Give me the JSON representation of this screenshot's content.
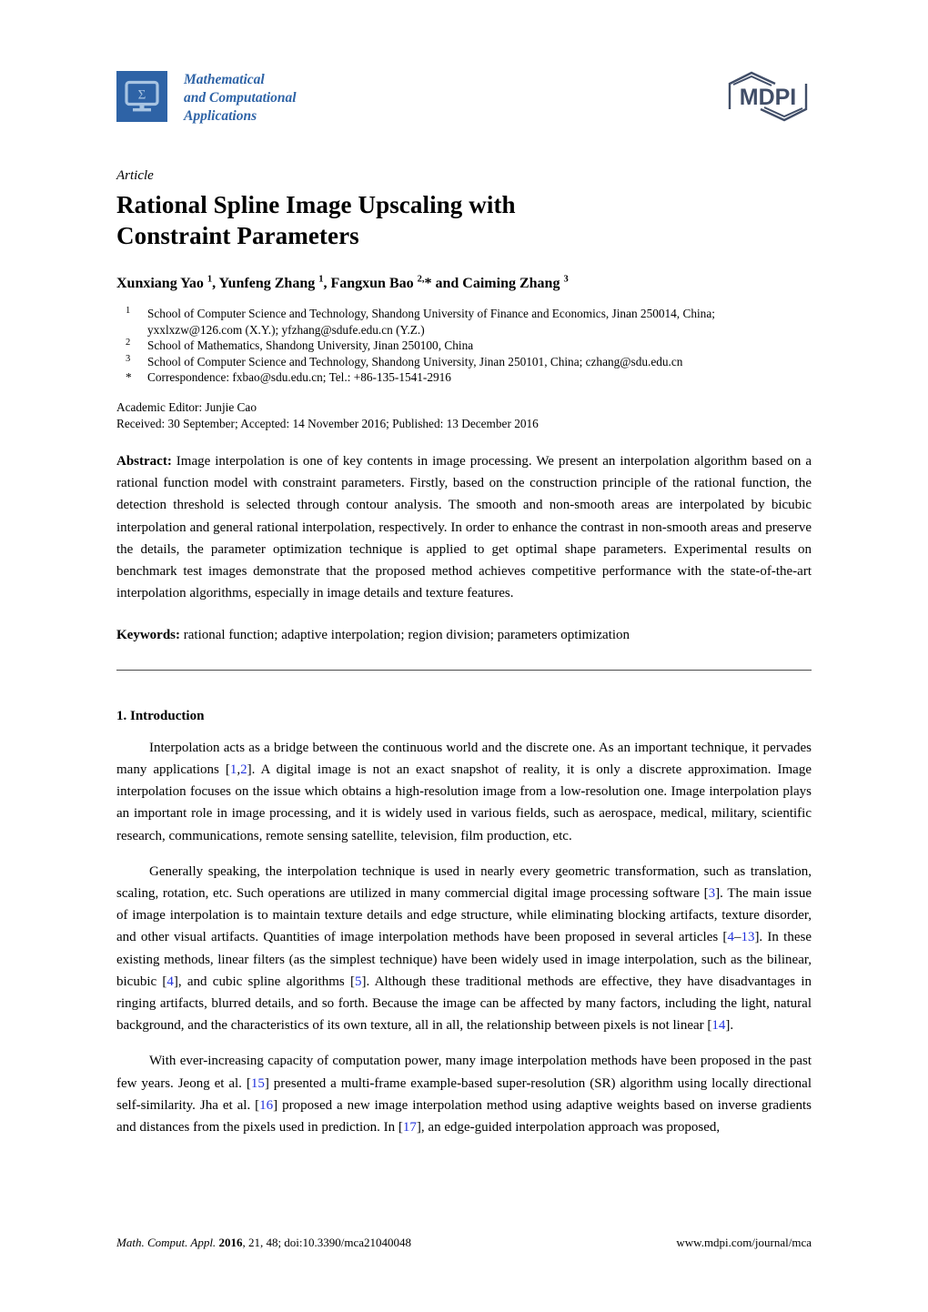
{
  "masthead": {
    "journal_name_lines": [
      "Mathematical",
      "and Computational",
      "Applications"
    ],
    "logo_sigma": "Σ",
    "publisher_logo_text": "MDPI",
    "brand_color": "#2E63A6",
    "publisher_color": "#414E68"
  },
  "article": {
    "type": "Article",
    "title_lines": [
      "Rational Spline Image Upscaling with",
      "Constraint Parameters"
    ],
    "authors_html": "Xunxiang Yao <sup>1</sup>, Yunfeng Zhang <sup>1</sup>, Fangxun Bao <sup>2,</sup>* and Caiming Zhang <sup>3</sup>"
  },
  "affiliations": [
    {
      "mark": "1",
      "text": "School of Computer Science and Technology, Shandong University of Finance and Economics, Jinan 250014, China; yxxlxzw@126.com (X.Y.); yfzhang@sdufe.edu.cn (Y.Z.)"
    },
    {
      "mark": "2",
      "text": "School of Mathematics, Shandong University, Jinan 250100, China"
    },
    {
      "mark": "3",
      "text": "School of Computer Science and Technology, Shandong University, Jinan 250101, China; czhang@sdu.edu.cn"
    },
    {
      "mark": "*",
      "text": "Correspondence: fxbao@sdu.edu.cn; Tel.: +86-135-1541-2916"
    }
  ],
  "editorial": {
    "academic_editor": "Academic Editor: Junjie Cao",
    "dates": "Received: 30 September; Accepted: 14 November 2016; Published: 13 December 2016"
  },
  "abstract": {
    "label": "Abstract:",
    "text": "Image interpolation is one of key contents in image processing. We present an interpolation algorithm based on a rational function model with constraint parameters. Firstly, based on the construction principle of the rational function, the detection  threshold is selected through contour analysis. The smooth and non-smooth areas are interpolated by bicubic interpolation and general rational interpolation, respectively. In order to enhance the contrast in non-smooth areas and preserve the details, the parameter optimization technique is applied to get optimal shape parameters. Experimental results on benchmark test images demonstrate that the proposed method achieves competitive performance with the state-of-the-art interpolation algorithms, especially in image details and texture features."
  },
  "keywords": {
    "label": "Keywords:",
    "text": "rational function; adaptive interpolation; region division; parameters optimization"
  },
  "body": {
    "section_1_heading": "1. Introduction",
    "paragraph_1_html": "Interpolation acts as a bridge between the continuous world and the discrete one. As an important technique, it pervades many applications [<span class=\"cite\">1</span>,<span class=\"cite\">2</span>]. A digital image is not an exact snapshot of reality, it is only a discrete approximation. Image interpolation focuses on the issue which obtains a high-resolution image from a low-resolution one. Image interpolation plays an important role in image processing, and it is widely used in various fields, such as aerospace, medical, military, scientific research, communications, remote sensing satellite, television, film production, etc.",
    "paragraph_2_html": "Generally speaking, the interpolation technique is used in nearly every geometric transformation, such as translation, scaling, rotation, etc. Such operations are utilized in many commercial digital image processing software [<span class=\"cite\">3</span>]. The main issue of image interpolation is to maintain texture details and edge structure, while eliminating blocking artifacts, texture disorder, and other visual artifacts. Quantities of image interpolation methods have been proposed in several articles [<span class=\"cite\">4</span>–<span class=\"cite\">13</span>]. In these existing methods, linear filters (as the simplest technique) have been widely used in image interpolation, such as the bilinear, bicubic [<span class=\"cite\">4</span>], and cubic spline algorithms [<span class=\"cite\">5</span>]. Although these traditional methods are effective, they have disadvantages in ringing artifacts, blurred details, and so forth. Because the image can be affected by many factors, including the light, natural background, and the characteristics of its own texture, all in all, the relationship between pixels is not linear [<span class=\"cite\">14</span>].",
    "paragraph_3_html": "With ever-increasing capacity of computation power, many image interpolation methods have been proposed in the past few years. Jeong et al. [<span class=\"cite\">15</span>] presented a multi-frame example-based super-resolution (SR) algorithm using locally directional self-similarity. Jha et al. [<span class=\"cite\">16</span>] proposed a new image interpolation method using adaptive weights based on inverse gradients and distances from the pixels used in prediction. In [<span class=\"cite\">17</span>], an edge-guided interpolation approach was proposed,"
  },
  "footer": {
    "citation_italic_1": "Math. Comput. Appl.",
    "citation_year": "2016",
    "citation_rest": ", 21, 48; doi:10.3390/mca21040048",
    "url": "www.mdpi.com/journal/mca"
  }
}
